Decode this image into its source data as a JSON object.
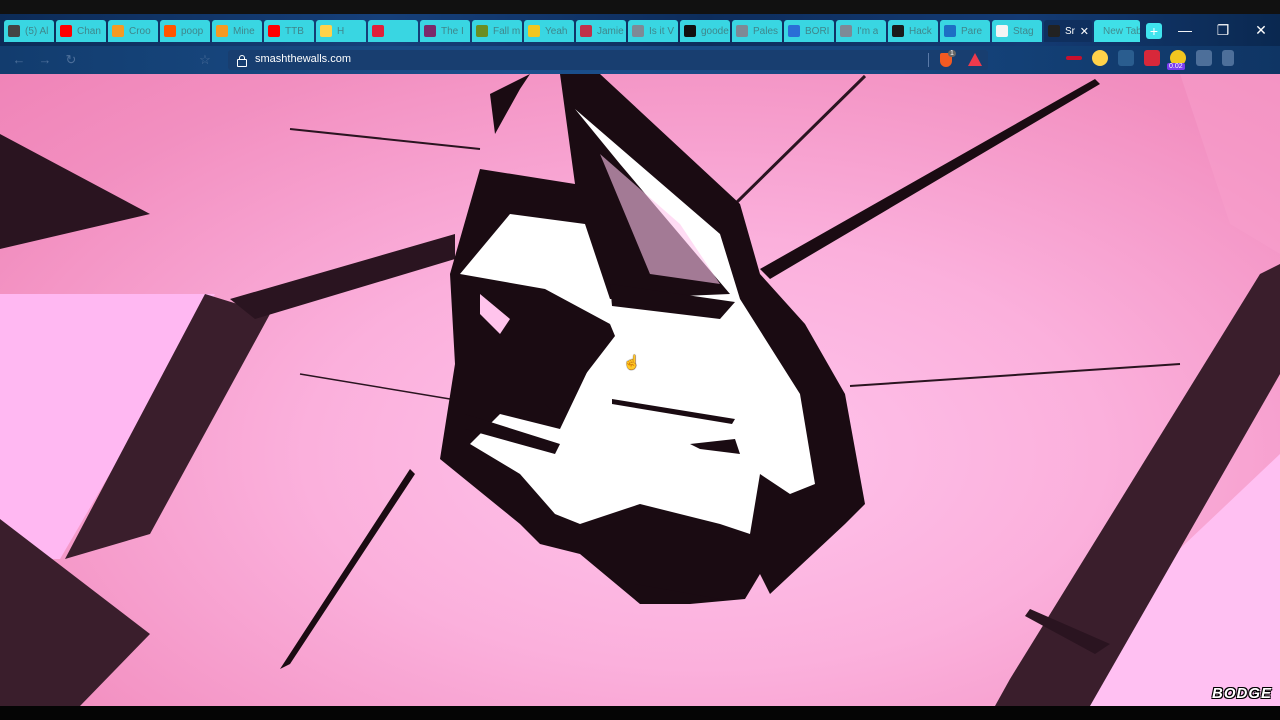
{
  "browser": {
    "tabs": [
      {
        "title": "(5) Al",
        "favicon": "roblox-icon",
        "color": "#444444"
      },
      {
        "title": "Chan",
        "favicon": "youtube-icon",
        "color": "#ff0000"
      },
      {
        "title": "Croo",
        "favicon": "pumpkin-icon",
        "color": "#f59a23"
      },
      {
        "title": "poop",
        "favicon": "soundcloud-icon",
        "color": "#ff5500"
      },
      {
        "title": "Mine",
        "favicon": "pumpkin-icon",
        "color": "#f59a23"
      },
      {
        "title": "TTB",
        "favicon": "youtube-icon",
        "color": "#ff0000"
      },
      {
        "title": "H",
        "favicon": "lemon-icon",
        "color": "#ffd24a"
      },
      {
        "title": "",
        "favicon": "record-icon",
        "color": "#e0203a"
      },
      {
        "title": "The I",
        "favicon": "square-icon",
        "color": "#7a2a6a"
      },
      {
        "title": "Fall m",
        "favicon": "game-icon",
        "color": "#6b8e23"
      },
      {
        "title": "Yeah",
        "favicon": "star-icon",
        "color": "#f2c61f"
      },
      {
        "title": "Jamie",
        "favicon": "bird-icon",
        "color": "#c0304a"
      },
      {
        "title": "Is it V",
        "favicon": "globe-icon",
        "color": "#7d8a96"
      },
      {
        "title": "goode",
        "favicon": "black-square-icon",
        "color": "#111111"
      },
      {
        "title": "Pales",
        "favicon": "globe-icon",
        "color": "#7d8a96"
      },
      {
        "title": "BORI",
        "favicon": "zzz-icon",
        "color": "#2a6fd6"
      },
      {
        "title": "I'm a",
        "favicon": "globe-icon",
        "color": "#7d8a96"
      },
      {
        "title": "Hack",
        "favicon": "ht-icon",
        "color": "#1a1a1a"
      },
      {
        "title": "Pare",
        "favicon": "blue-box-icon",
        "color": "#1d6fc4"
      },
      {
        "title": "Stag",
        "favicon": "white-square-icon",
        "color": "#f4f4f4"
      },
      {
        "title": "Sr",
        "favicon": "smash-icon",
        "color": "#222222",
        "active": true
      },
      {
        "title": "New Tab",
        "favicon": "",
        "color": "#3fe0e8"
      }
    ],
    "new_tab_button": "+",
    "window_controls": {
      "minimize": "—",
      "maximize": "❐",
      "close": "✕"
    },
    "url": "smashthewalls.com",
    "brave_badge": "1",
    "extension_badge": "0.02",
    "nav": {
      "back": "←",
      "forward": "→",
      "reload": "↻",
      "home": "⌂"
    }
  },
  "page": {
    "watermark": "BODGE",
    "cursor": "hand-pointer-icon",
    "colors": {
      "background": "#f9a6d6",
      "shard": "#1a0b12",
      "white": "#ffffff"
    }
  }
}
